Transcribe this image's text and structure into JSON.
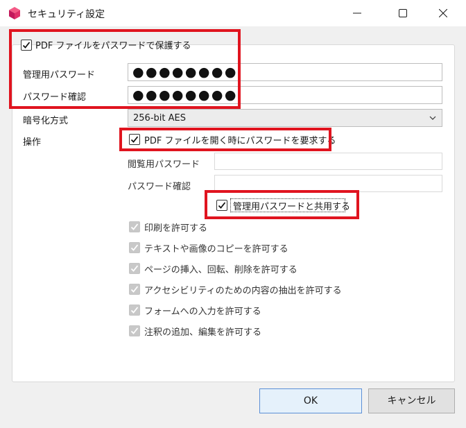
{
  "window": {
    "title": "セキュリティ設定"
  },
  "protect": {
    "checkbox_label": "PDF ファイルをパスワードで保護する",
    "checked": true,
    "admin_password_label": "管理用パスワード",
    "admin_password_value": "●●●●●●●●",
    "confirm_password_label": "パスワード確認",
    "confirm_password_value": "●●●●●●●●"
  },
  "encryption": {
    "label": "暗号化方式",
    "selected": "256-bit AES"
  },
  "operations": {
    "label": "操作",
    "require_open_label": "PDF ファイルを開く時にパスワードを要求する",
    "require_open_checked": true,
    "view_password_label": "閲覧用パスワード",
    "view_password_value": "",
    "view_confirm_label": "パスワード確認",
    "view_confirm_value": "",
    "share_admin_label": "管理用パスワードと共用する",
    "share_admin_checked": true
  },
  "permissions": [
    {
      "label": "印刷を許可する",
      "checked": true
    },
    {
      "label": "テキストや画像のコピーを許可する",
      "checked": true
    },
    {
      "label": "ページの挿入、回転、削除を許可する",
      "checked": true
    },
    {
      "label": "アクセシビリティのための内容の抽出を許可する",
      "checked": true
    },
    {
      "label": "フォームへの入力を許可する",
      "checked": true
    },
    {
      "label": "注釈の追加、編集を許可する",
      "checked": true
    }
  ],
  "buttons": {
    "ok": "OK",
    "cancel": "キャンセル"
  },
  "colors": {
    "highlight": "#e0141f",
    "accent": "#5b8fd6"
  }
}
